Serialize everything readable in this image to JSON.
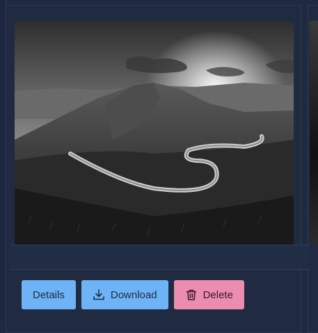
{
  "card": {
    "image_alt": "Black and white photo of a winding road through hills at sunset",
    "actions": {
      "details_label": "Details",
      "download_label": "Download",
      "delete_label": "Delete"
    },
    "icons": {
      "download": "download-icon",
      "delete": "trash-icon"
    },
    "colors": {
      "page_bg": "#1f2a40",
      "primary_button": "#6fb3f7",
      "danger_button": "#ec8db0"
    }
  }
}
